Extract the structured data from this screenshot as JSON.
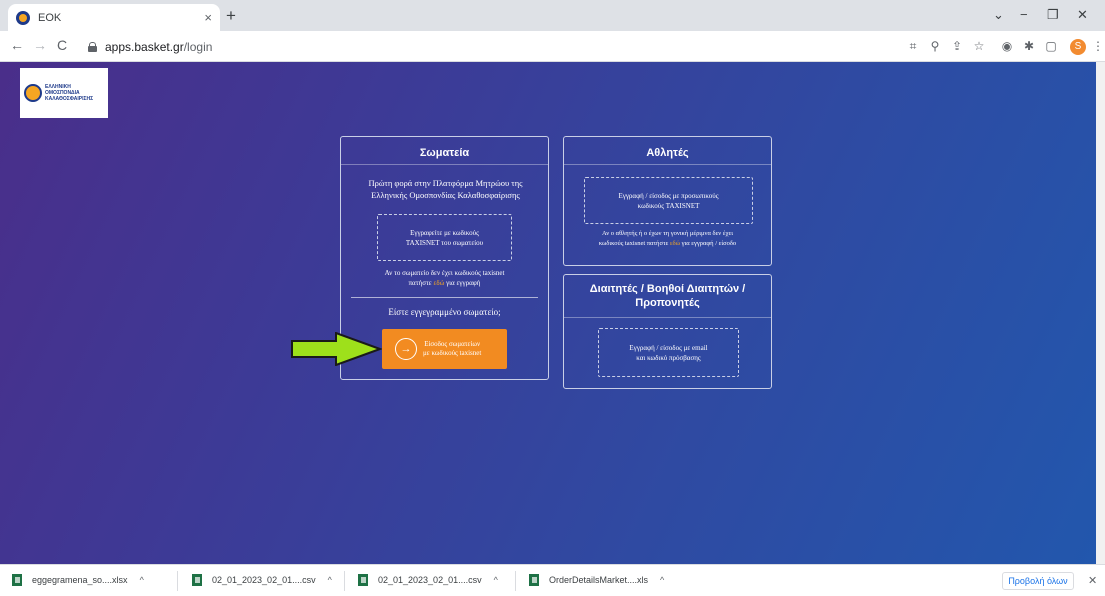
{
  "browser": {
    "tab_title": "ΕΟΚ",
    "tab_close": "×",
    "new_tab": "+",
    "url_host": "apps.basket.gr",
    "url_path": "/login",
    "back": "←",
    "forward": "→",
    "reload": "C",
    "minimize": "−",
    "restore": "❐",
    "close": "✕",
    "tab_search": "⌄",
    "profile_initial": "S",
    "menu": "⋮"
  },
  "logo": {
    "lines": [
      "ΕΛΛΗΝΙΚΗ",
      "ΟΜΟΣΠΟΝΔΙΑ",
      "ΚΑΛΑΘΟΣΦΑΙΡΙΣΗΣ"
    ]
  },
  "clubs_card": {
    "title": "Σωματεία",
    "intro": "Πρώτη φορά στην Πλατφόρμα Μητρώου της Ελληνικής Ομοσπονδίας Καλαθοσφαίρισης",
    "register_line1": "Εγγραφείτε με κωδικούς",
    "register_line2": "TAXISNET του σωματείου",
    "no_codes_text": "Αν το σωματείο δεν έχει κωδικούς taxisnet",
    "no_codes_prefix": "πατήστε ",
    "no_codes_link": "εδώ",
    "no_codes_suffix": " για εγγραφή",
    "registered_question": "Είστε εγγεγραμμένο σωματείο;",
    "login_btn_line1": "Είσοδος σωματείων",
    "login_btn_line2": "με κωδικούς taxisnet",
    "login_btn_icon": "→"
  },
  "athletes_card": {
    "title": "Αθλητές",
    "btn_line1": "Εγγραφή / είσοδος με προσωπικούς",
    "btn_line2": "κωδικούς TAXISNET",
    "minor_line1": "Αν ο αθλητής ή ο έχων τη γονική μέριμνα δεν έχει",
    "minor_prefix": "κωδικούς taxisnet πατήστε ",
    "minor_link": "εδώ",
    "minor_suffix": " για εγγραφή / είσοδο"
  },
  "referees_card": {
    "title_line1": "Διαιτητές / Βοηθοί Διαιτητών /",
    "title_line2": "Προπονητές",
    "btn_line1": "Εγγραφή / είσοδος με email",
    "btn_line2": "και κωδικό πρόσβασης"
  },
  "downloads": {
    "items": [
      {
        "name": "eggegramena_so....xlsx"
      },
      {
        "name": "02_01_2023_02_01....csv"
      },
      {
        "name": "02_01_2023_02_01....csv"
      },
      {
        "name": "OrderDetailsMarket....xls"
      }
    ],
    "caret": "^",
    "show_all": "Προβολή όλων",
    "close": "✕"
  },
  "colors": {
    "accent": "#f28b21",
    "arrow": "#9ee01b",
    "link": "#f5a623",
    "bg_start": "#4a2e8a",
    "bg_end": "#2257ad"
  }
}
